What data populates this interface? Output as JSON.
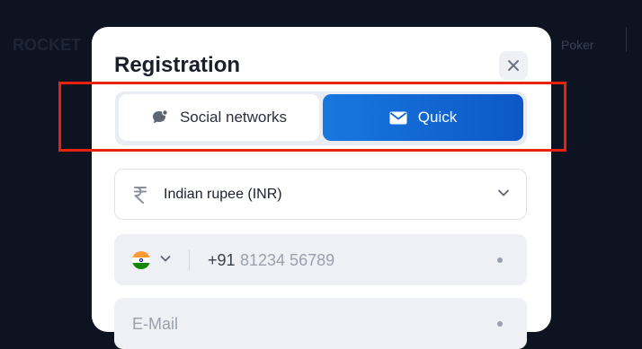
{
  "background": {
    "left_text": "ROCKET",
    "right_text": "Poker"
  },
  "modal": {
    "title": "Registration",
    "close_icon": "close-icon"
  },
  "tabs": [
    {
      "label": "Social networks",
      "icon": "chat-bubble-icon",
      "active": false
    },
    {
      "label": "Quick",
      "icon": "envelope-icon",
      "active": true
    }
  ],
  "form": {
    "currency": {
      "icon": "rupee-icon",
      "value": "Indian rupee (INR)"
    },
    "phone": {
      "country_flag": "india-flag-icon",
      "code": "+91",
      "placeholder": "81234 56789"
    },
    "email": {
      "placeholder": "E-Mail"
    }
  },
  "colors": {
    "accent": "#1877e0",
    "highlight": "#e8220c",
    "background": "#0d1320"
  }
}
